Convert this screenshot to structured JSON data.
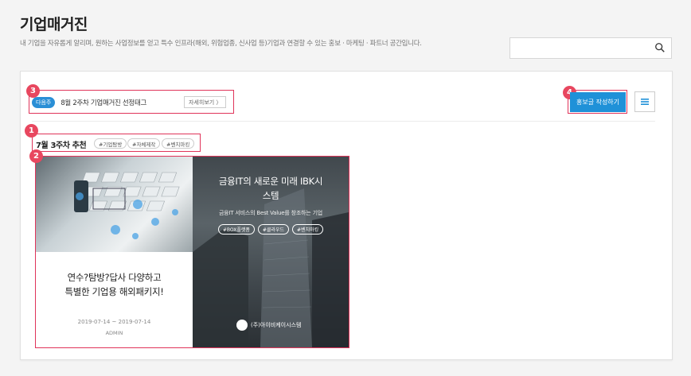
{
  "page": {
    "title": "기업매거진",
    "description": "내 기업을 자유롭게 알리며, 원하는 사업정보를 얻고 특수 인프라(해외, 위험업종, 신사업 등)기업과 연결할 수 있는 홍보 · 마케팅 · 파트너 공간입니다."
  },
  "search": {
    "placeholder": "",
    "icon": "search-icon"
  },
  "notice": {
    "badge": "다음주",
    "text": "8월 2주차 기업매거진 선정태그",
    "more_label": "자세히보기 〉"
  },
  "toolbar": {
    "write_label": "홍보글 작성하기",
    "menu_icon": "menu-icon"
  },
  "weekly": {
    "title": "7월 3주차 추천",
    "tags": [
      "#기업탐방",
      "#자체제작",
      "#벤치마킹"
    ]
  },
  "card_left": {
    "title_line1": "연수?탐방?답사 다양하고",
    "title_line2": "특별한 기업용 해외패키지!",
    "date": "2019-07-14 ~ 2019-07-14",
    "author": "ADMIN"
  },
  "card_right": {
    "title_line1": "금융IT의 새로운 미래 IBK시",
    "title_line2": "스템",
    "subtitle": "금융IT 서비스의 Best Value를 창조하는 기업",
    "tags": [
      "#BOX플랫폼",
      "#클라우드",
      "#벤치마킹"
    ],
    "company": "(주)아이비케이시스템"
  },
  "annotations": [
    "1",
    "2",
    "3",
    "4"
  ],
  "colors": {
    "accent": "#1f91d8",
    "highlight": "#e0345a",
    "badge_blue": "#2a8fd6"
  }
}
